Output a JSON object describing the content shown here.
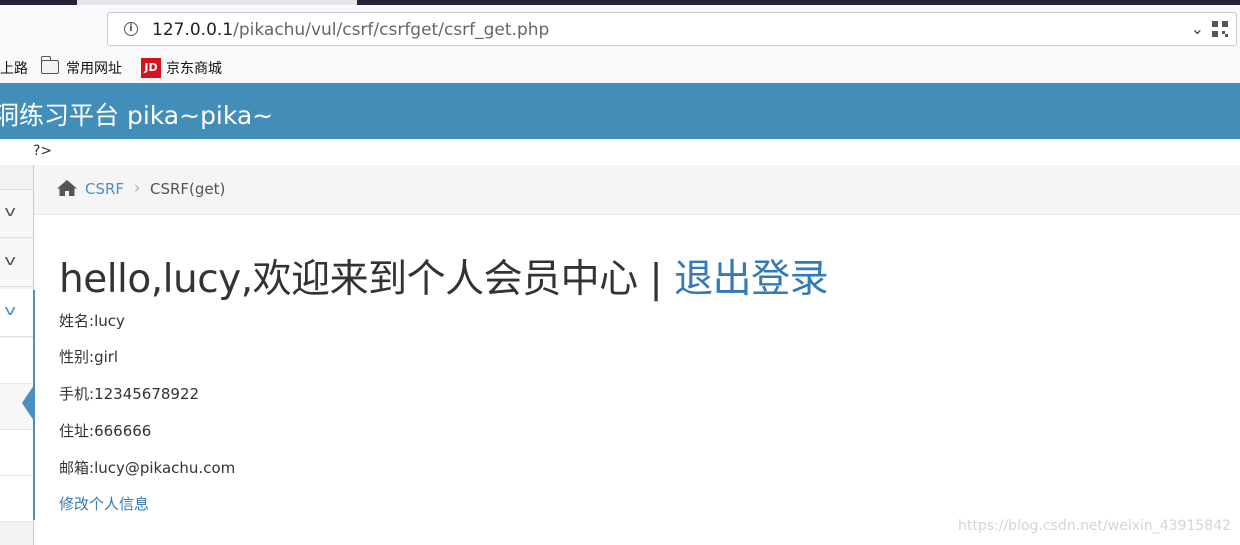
{
  "browser": {
    "url_host": "127.0.0.1",
    "url_path": "/pikachu/vul/csrf/csrfget/csrf_get.php",
    "bookmarks": [
      {
        "label": "上路",
        "icon": "none"
      },
      {
        "label": "常用网址",
        "icon": "folder-icon"
      },
      {
        "label": "京东商城",
        "icon": "jd-icon"
      }
    ],
    "jd_icon_text": "JD"
  },
  "header": {
    "title": "洞练习平台 pika~pika~"
  },
  "stray_text": "?>",
  "breadcrumb": {
    "home_link": "CSRF",
    "separator": "›",
    "current": "CSRF(get)"
  },
  "main": {
    "greeting": "hello,lucy,欢迎来到个人会员中心 | ",
    "logout_link": "退出登录",
    "fields": [
      {
        "label": "姓名:",
        "value": "lucy"
      },
      {
        "label": "性别:",
        "value": "girl"
      },
      {
        "label": "手机:",
        "value": "12345678922"
      },
      {
        "label": "住址:",
        "value": "666666"
      },
      {
        "label": "邮箱:",
        "value": "lucy@pikachu.com"
      }
    ],
    "edit_link": "修改个人信息"
  },
  "watermark": "https://blog.csdn.net/weixin_43915842",
  "colors": {
    "header_bg": "#438eb9",
    "link": "#337ab7",
    "active_accent": "#4a8ec2"
  }
}
